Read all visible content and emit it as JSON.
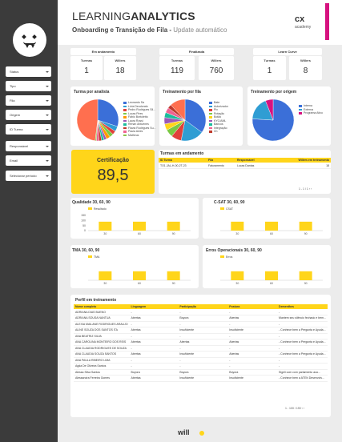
{
  "sidebar": {
    "filters": [
      {
        "label": "Status"
      },
      {
        "label": "Tipo"
      },
      {
        "label": "Fila"
      },
      {
        "label": "Origem"
      },
      {
        "label": "ID Turma"
      },
      {
        "label": "Responsável"
      },
      {
        "label": "Email"
      },
      {
        "label": "Selecionar período"
      }
    ]
  },
  "header": {
    "title_light": "LEARNING",
    "title_bold": "ANALYTICS",
    "subtitle": "Onboarding e Transição de Fila -",
    "update": "Update automático",
    "logo": "cx",
    "logo_sub": "academy"
  },
  "kpis": [
    {
      "title": "Em andamento",
      "items": [
        {
          "label": "Turmas",
          "value": "1"
        },
        {
          "label": "Willers",
          "value": "18"
        }
      ]
    },
    {
      "title": "Finalizada",
      "items": [
        {
          "label": "Turmas",
          "value": "119"
        },
        {
          "label": "Willers",
          "value": "760"
        }
      ]
    },
    {
      "title": "Learn Curve",
      "items": [
        {
          "label": "Turmas",
          "value": "1"
        },
        {
          "label": "Willers",
          "value": "8"
        }
      ]
    }
  ],
  "colors": {
    "accent": "#ffd51a",
    "brand": "#d6127f",
    "sidebar": "#3b3b3b"
  },
  "pies": [
    {
      "title": "Turma por analista",
      "slices": [
        {
          "label": "Leonardo Sa",
          "value": 30,
          "color": "#3b6fd8"
        },
        {
          "label": "Lívia Deodorato",
          "value": 4,
          "color": "#2f9dd3"
        },
        {
          "label": "Pedro Rodrigues Sil...",
          "value": 3,
          "color": "#e0413a"
        },
        {
          "label": "Lucas Pires",
          "value": 3,
          "color": "#7ac943"
        },
        {
          "label": "Fábio Bortoletto",
          "value": 3,
          "color": "#ff9a00"
        },
        {
          "label": "Laura Rossi",
          "value": 2,
          "color": "#9b59b6"
        },
        {
          "label": "Renan Antuenes",
          "value": 2,
          "color": "#1abc9c"
        },
        {
          "label": "Flávia Rodrigues Su...",
          "value": 2,
          "color": "#c0392b"
        },
        {
          "label": "Paula Alves",
          "value": 2,
          "color": "#f06292"
        },
        {
          "label": "Matheus",
          "value": 1,
          "color": "#8bc34a"
        },
        {
          "label": "others",
          "value": 48,
          "color": "#ff6f4f"
        }
      ]
    },
    {
      "title": "Treinamento por fila",
      "slices": [
        {
          "label": "Bate",
          "value": 35,
          "color": "#3b6fd8"
        },
        {
          "label": "Autorizador",
          "value": 18,
          "color": "#2f9dd3"
        },
        {
          "label": "Pix",
          "value": 8,
          "color": "#e0413a"
        },
        {
          "label": "Rotação",
          "value": 6,
          "color": "#7ac943"
        },
        {
          "label": "Botão",
          "value": 5,
          "color": "#ffd51a"
        },
        {
          "label": "KYC/AML",
          "value": 5,
          "color": "#9b59b6"
        },
        {
          "label": "Bancos",
          "value": 4,
          "color": "#1abc9c"
        },
        {
          "label": "Integração",
          "value": 4,
          "color": "#f06292"
        },
        {
          "label": "Ch",
          "value": 3,
          "color": "#c0392b"
        },
        {
          "label": "others",
          "value": 12,
          "color": "#ff6f4f"
        }
      ]
    },
    {
      "title": "Treinamento por origem",
      "slices": [
        {
          "label": "Interna",
          "value": 76,
          "color": "#3b6fd8"
        },
        {
          "label": "Externa",
          "value": 18,
          "color": "#2f9dd3"
        },
        {
          "label": "Programa Ativo",
          "value": 6,
          "color": "#d6127f"
        }
      ]
    }
  ],
  "certificacao": {
    "label": "Certificação",
    "value": "89,5"
  },
  "turmas": {
    "title": "Turmas em andamento",
    "headers": [
      "ID Turma",
      "Fila",
      "Responsável",
      "Willers em treinamento"
    ],
    "rows": [
      [
        "TO1.JAL-H-00-2T-23",
        "Faturamento",
        "Lucas Dantas",
        "18"
      ]
    ],
    "pager": "1 - 1 / 1"
  },
  "bar_charts": [
    {
      "title": "Qualidade 30, 60, 90",
      "legend": "Resultado",
      "yticks": [
        "150",
        "100",
        "50",
        "0"
      ],
      "chart_data": {
        "type": "bar",
        "categories": [
          "30",
          "60",
          "90"
        ],
        "values": [
          88,
          88,
          88
        ],
        "ylim": [
          0,
          150
        ]
      }
    },
    {
      "title": "C-SAT 30, 60, 90",
      "legend": "CSAT",
      "yticks": [],
      "chart_data": {
        "type": "bar",
        "categories": [
          "30",
          "60",
          "90"
        ],
        "values": [
          88,
          88,
          88
        ],
        "ylim": [
          0,
          150
        ]
      }
    },
    {
      "title": "TMA 30, 60, 90",
      "legend": "TMA",
      "yticks": [],
      "chart_data": {
        "type": "bar",
        "categories": [
          "30",
          "60",
          "90"
        ],
        "values": [
          80,
          80,
          80
        ],
        "ylim": [
          0,
          150
        ]
      }
    },
    {
      "title": "Erros Operacionais 30, 60, 90",
      "legend": "Erros",
      "yticks": [],
      "chart_data": {
        "type": "bar",
        "categories": [
          "30",
          "60",
          "90"
        ],
        "values": [
          80,
          80,
          80
        ],
        "ylim": [
          0,
          150
        ]
      }
    }
  ],
  "perfil": {
    "title": "Perfil em treinamento",
    "headers": [
      "Nome completo",
      "Linguagem",
      "Participação",
      "Postura",
      "Dementhes"
    ],
    "rows": [
      [
        "ADRIANA DIAS BUENO",
        "-",
        "-",
        "-",
        "-"
      ],
      [
        "ADRIANA SOUSA NANTUA",
        "Abertas",
        "Boyora",
        "Abertas",
        "Mantem seu silêncio fechado e bem..."
      ],
      [
        "ALEXIA MAILANE RODRIGUES ARAUJO",
        "-",
        "-",
        "-",
        "-"
      ],
      [
        "ALINE SOUZA DOS SANTOS ITA",
        "Abertas",
        "Insuficiente",
        "Insuficiente",
        "- Conhece bem a Pergunta e Ayuda..."
      ],
      [
        "ANA BEATRIZ SILVA",
        "-",
        "-",
        "-",
        "-"
      ],
      [
        "ANA CAROLINA MONTEIRO DOS REIS",
        "Abertas",
        "Abertas",
        "Abertas",
        "- Conhece bem a Pergunta e Ayuda..."
      ],
      [
        "ANA CLAUDIA RODRIGUES DE SOUZA",
        "-",
        "-",
        "-",
        "-"
      ],
      [
        "ANA CLAUDIA SOUZA SANTOS",
        "Abertas",
        "Insuficiente",
        "Abertas",
        "- Conhece bem a Pergunta e Ayuda..."
      ],
      [
        "ANA PAULA RIBEIRO LIMA",
        "-",
        "-",
        "-",
        "-"
      ],
      [
        "Agda De Oliveira Santos",
        "-",
        "-",
        "-",
        "-"
      ],
      [
        "Alessa Silva Santos",
        "Boyora",
        "Boyora",
        "Boyora",
        "Sigeli com com parlamento aca..."
      ],
      [
        "Alessandra Ferreira Gomes",
        "Abertas",
        "Insuficiente",
        "Insuficiente",
        "- Conhece bem a ATEN Desenvolv..."
      ]
    ],
    "pager": "1 - 100 / 190"
  },
  "footer": "will"
}
